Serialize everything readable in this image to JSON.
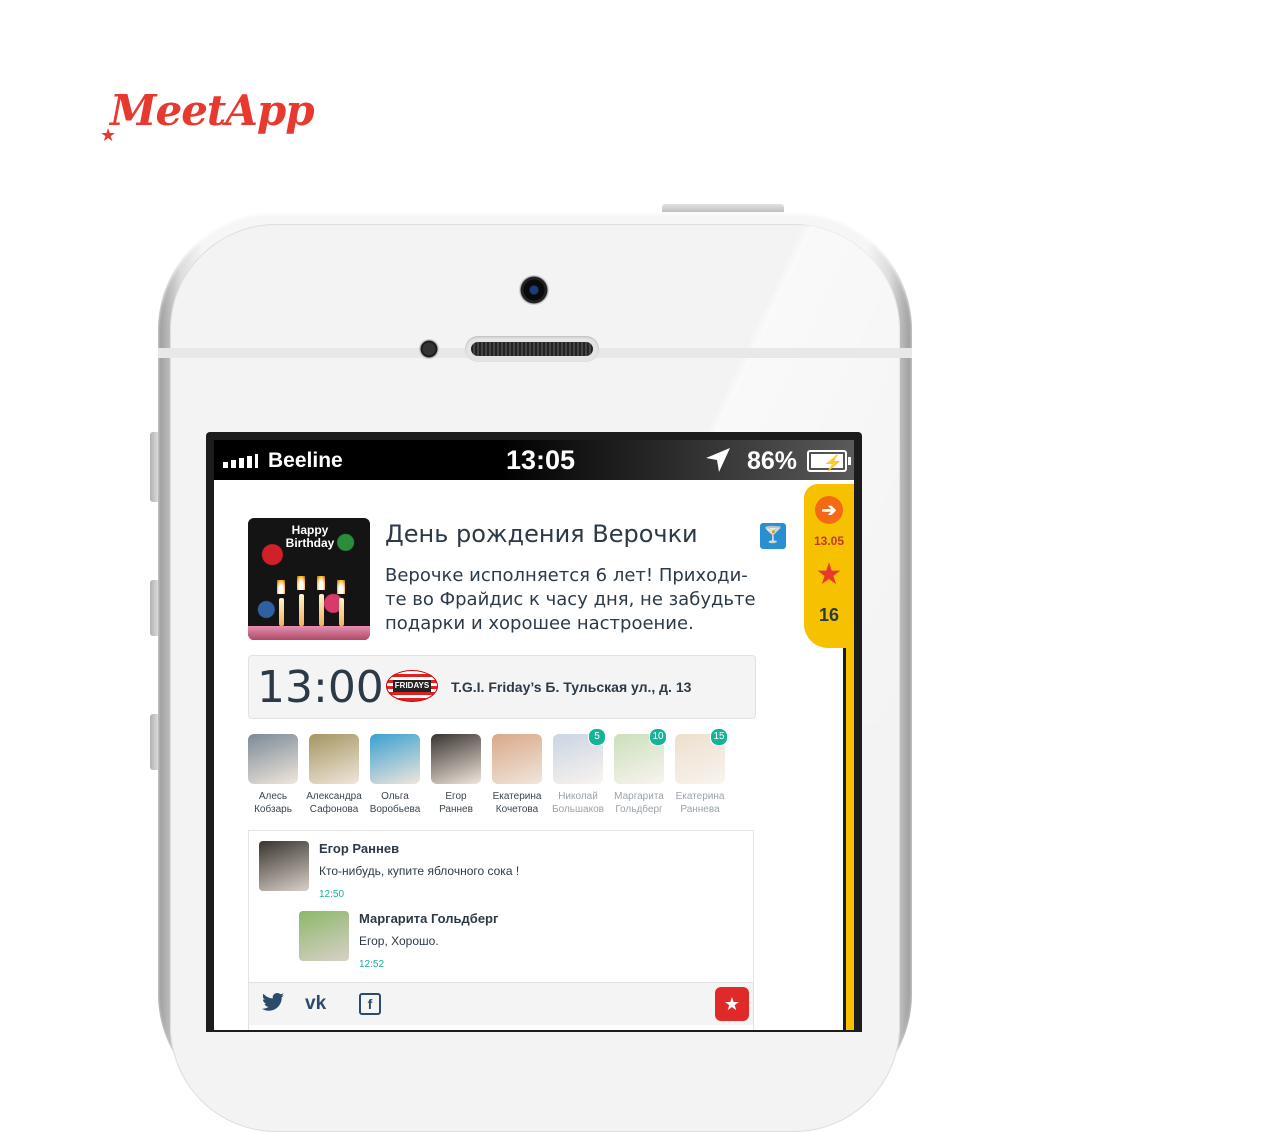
{
  "brand": {
    "name": "MeetApp",
    "color": "#e8392e"
  },
  "status_bar": {
    "carrier": "Beeline",
    "time": "13:05",
    "battery": "86%"
  },
  "event": {
    "title": "День рождения Верочки",
    "description": "Верочке исполняется 6 лет! Приходи-те во Фрайдис к часу дня, не забудьте подарки и хорошее настроение.",
    "image_text": "Happy Birthday",
    "category_icon": "cocktail-icon",
    "time": "13:00",
    "place": "T.G.I. Friday’s Б. Тульская ул., д. 13",
    "venue_logo_text": "FRIDAYS"
  },
  "side_tab": {
    "date": "13.05",
    "star_count": "16",
    "accent": "#f6c200"
  },
  "participants": [
    {
      "first": "Алесь",
      "last": "Кобзарь",
      "badge": null,
      "dim": false,
      "color": "#7a8a96"
    },
    {
      "first": "Александра",
      "last": "Сафонова",
      "badge": null,
      "dim": false,
      "color": "#a49560"
    },
    {
      "first": "Ольга",
      "last": "Воробьева",
      "badge": null,
      "dim": false,
      "color": "#3aa0d0"
    },
    {
      "first": "Егор",
      "last": "Раннев",
      "badge": null,
      "dim": false,
      "color": "#3a3430"
    },
    {
      "first": "Екатерина",
      "last": "Кочетова",
      "badge": null,
      "dim": false,
      "color": "#d9a888"
    },
    {
      "first": "Николай",
      "last": "Большаков",
      "badge": "5",
      "dim": true,
      "color": "#8aa0c0"
    },
    {
      "first": "Маргарита",
      "last": "Гольдберг",
      "badge": "10",
      "dim": true,
      "color": "#8cb86a"
    },
    {
      "first": "Екатерина",
      "last": "Раннева",
      "badge": "15",
      "dim": true,
      "color": "#d8b890"
    }
  ],
  "comments": [
    {
      "author": "Егор Раннев",
      "text": "Кто-нибудь, купите яблочного сока !",
      "time": "12:50",
      "color": "#3a3430"
    },
    {
      "author": "Маргарита Гольдберг",
      "text": "Егор, Хорошо.",
      "time": "12:52",
      "color": "#8cb86a"
    }
  ],
  "share": {
    "twitter": "twitter-icon",
    "vk": "vk-icon",
    "facebook": "facebook-icon",
    "favorite_color": "#e02a2a"
  }
}
